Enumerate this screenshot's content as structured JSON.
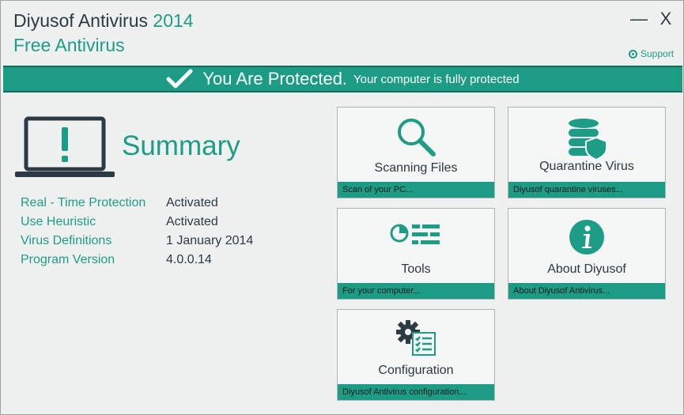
{
  "app": {
    "title_name": "Diyusof Antivirus",
    "title_year": "2014",
    "subtitle": "Free Antivirus",
    "minimize_label": "—",
    "close_label": "X",
    "support_label": "Support"
  },
  "banner": {
    "status": "You Are Protected.",
    "detail": "Your computer is fully protected",
    "icon": "checkmark-icon"
  },
  "summary": {
    "title": "Summary",
    "rows": [
      {
        "label": "Real - Time Protection",
        "value": "Activated"
      },
      {
        "label": "Use Heuristic",
        "value": "Activated"
      },
      {
        "label": "Virus Definitions",
        "value": "1 January 2014"
      },
      {
        "label": "Program Version",
        "value": "4.0.0.14"
      }
    ]
  },
  "tiles": [
    {
      "title": "Scanning Files",
      "footer": "Scan of your PC...",
      "icon": "magnifier-icon"
    },
    {
      "title": "Quarantine Virus",
      "footer": "Diyusof quarantine viruses...",
      "icon": "database-shield-icon"
    },
    {
      "title": "Tools",
      "footer": "For your computer...",
      "icon": "tools-icon"
    },
    {
      "title": "About Diyusof",
      "footer": "About Diyusof Antivirus...",
      "icon": "info-icon"
    },
    {
      "title": "Configuration",
      "footer": "Diyusof Antivirus configuration...",
      "icon": "gear-list-icon"
    }
  ],
  "colors": {
    "accent": "#1e9d86",
    "banner": "#1c9c84",
    "dark": "#2b3a44",
    "background": "#eef1f0"
  }
}
